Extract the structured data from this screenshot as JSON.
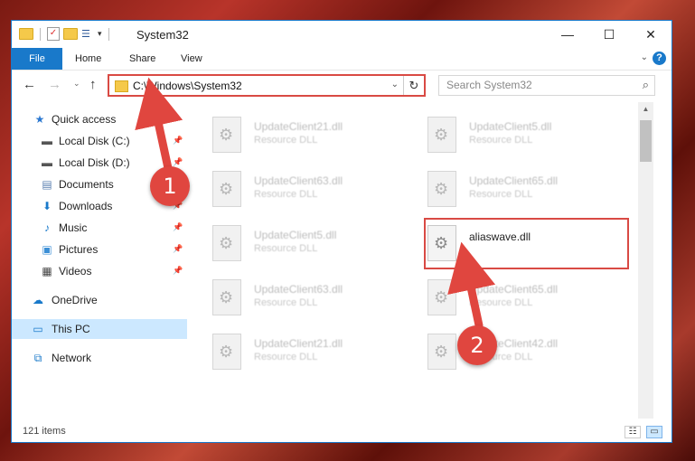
{
  "window": {
    "title": "System32",
    "controls": {
      "minimize": "—",
      "maximize": "☐",
      "close": "✕"
    }
  },
  "ribbon": {
    "tabs": [
      "File",
      "Home",
      "Share",
      "View"
    ],
    "help": "?"
  },
  "address": {
    "path": "C:\\Windows\\System32",
    "search_placeholder": "Search System32"
  },
  "sidebar": {
    "items": [
      {
        "label": "Quick access",
        "icon": "star-icon",
        "pinned": false
      },
      {
        "label": "Local Disk (C:)",
        "icon": "drive-icon",
        "pinned": true
      },
      {
        "label": "Local Disk (D:)",
        "icon": "drive-icon",
        "pinned": true
      },
      {
        "label": "Documents",
        "icon": "document-icon",
        "pinned": true
      },
      {
        "label": "Downloads",
        "icon": "download-icon",
        "pinned": true
      },
      {
        "label": "Music",
        "icon": "music-icon",
        "pinned": true
      },
      {
        "label": "Pictures",
        "icon": "pictures-icon",
        "pinned": true
      },
      {
        "label": "Videos",
        "icon": "video-icon",
        "pinned": true
      },
      {
        "label": "OneDrive",
        "icon": "cloud-icon",
        "pinned": false
      },
      {
        "label": "This PC",
        "icon": "computer-icon",
        "pinned": false,
        "selected": true
      },
      {
        "label": "Network",
        "icon": "network-icon",
        "pinned": false
      }
    ]
  },
  "files": [
    {
      "name": "UpdateClient21.dll",
      "type": "Resource DLL"
    },
    {
      "name": "UpdateClient5.dll",
      "type": "Resource DLL"
    },
    {
      "name": "UpdateClient63.dll",
      "type": "Resource DLL"
    },
    {
      "name": "UpdateClient65.dll",
      "type": "Resource DLL"
    },
    {
      "name": "UpdateClient5.dll",
      "type": "Resource DLL"
    },
    {
      "name": "aliaswave.dll",
      "type": "",
      "highlighted": true
    },
    {
      "name": "UpdateClient63.dll",
      "type": "Resource DLL"
    },
    {
      "name": "UpdateClient65.dll",
      "type": "Resource DLL"
    },
    {
      "name": "UpdateClient21.dll",
      "type": "Resource DLL"
    },
    {
      "name": "UpdateClient42.dll",
      "type": "Resource DLL"
    }
  ],
  "status": {
    "item_count": "121 items"
  },
  "annotations": [
    {
      "label": "1"
    },
    {
      "label": "2"
    }
  ],
  "colors": {
    "accent": "#1979ca",
    "highlight": "#d94a44",
    "selection": "#cce8ff"
  }
}
